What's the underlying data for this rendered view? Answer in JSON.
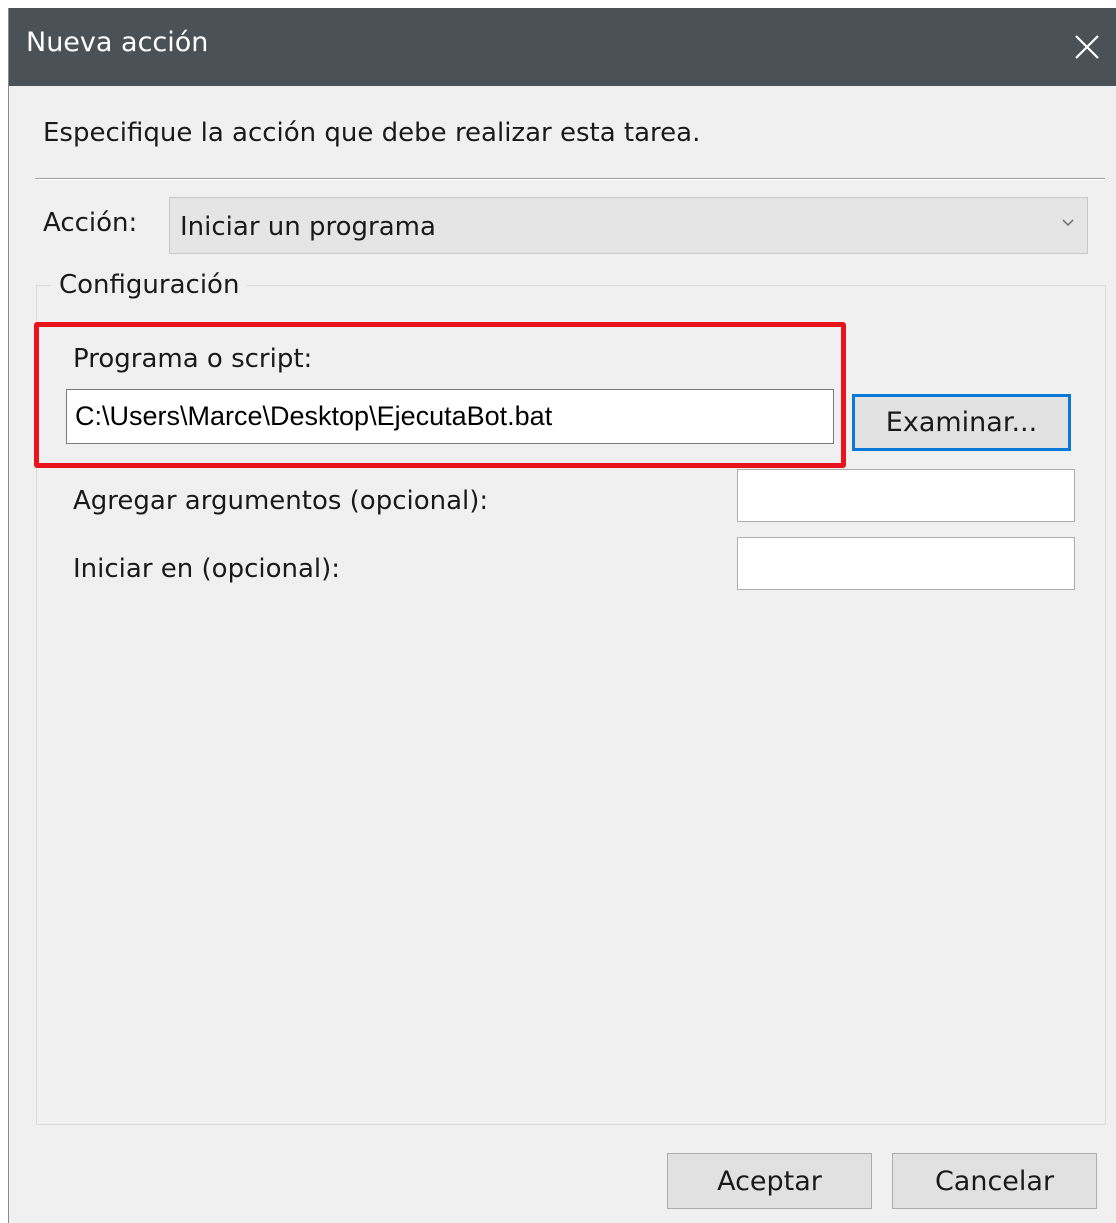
{
  "window": {
    "title": "Nueva acción"
  },
  "instruction": "Especifique la acción que debe realizar esta tarea.",
  "action": {
    "label": "Acción:",
    "selected": "Iniciar un programa"
  },
  "config": {
    "legend": "Configuración",
    "program": {
      "label": "Programa o script:",
      "value": "C:\\Users\\Marce\\Desktop\\EjecutaBot.bat"
    },
    "browse_label": "Examinar...",
    "arguments": {
      "label": "Agregar argumentos (opcional):",
      "value": ""
    },
    "start_in": {
      "label": "Iniciar en (opcional):",
      "value": ""
    }
  },
  "buttons": {
    "ok": "Aceptar",
    "cancel": "Cancelar"
  },
  "colors": {
    "titlebar": "#4a5157",
    "highlight": "#e8141c",
    "focus": "#0a78d7"
  },
  "icons": {
    "close": "close-icon",
    "dropdown": "chevron-down-icon"
  }
}
